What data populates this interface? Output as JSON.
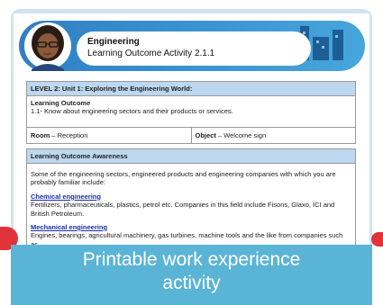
{
  "header": {
    "title": "Engineering",
    "subtitle": "Learning Outcome Activity 2.1.1"
  },
  "unit_table": {
    "heading": "LEVEL 2:  Unit 1: Exploring the Engineering World:",
    "outcome_label": "Learning Outcome",
    "outcome_text": "1.1- Know about engineering sectors and their products or services.",
    "room_label": "Room",
    "room_value": "Reception",
    "object_label": "Object",
    "object_value": "Welcome sign"
  },
  "awareness": {
    "heading": "Learning Outcome Awareness",
    "intro": "Some of the engineering sectors, engineered products and engineering companies with which you are probably familiar include:",
    "sections": [
      {
        "title": "Chemical engineering",
        "text": "Fertilizers, pharmaceuticals, plastics, petrol etc. Companies in this field include Fisons, Glaxo, ICI and British Petroleum."
      },
      {
        "title": "Mechanical engineering",
        "text": "Engines, bearings, agricultural machinery, gas turbines, machine tools and the like from companies such as"
      }
    ]
  },
  "overlay": {
    "line1": "Printable work experience",
    "line2": "activity"
  },
  "colors": {
    "banner_blue": "#5ab4d6",
    "header_blue": "#bdd7ee",
    "accent_red": "#e2323a",
    "link_blue": "#1a2ea8"
  }
}
